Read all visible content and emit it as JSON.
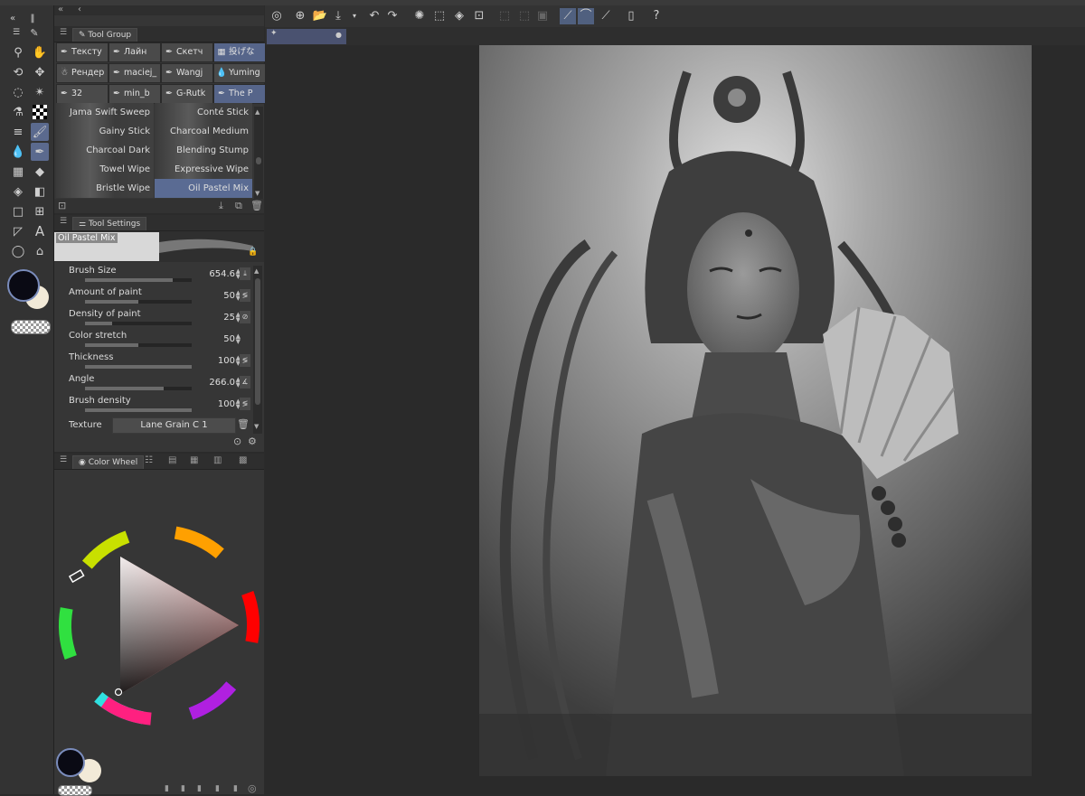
{
  "panels": {
    "tool_group_title": "Tool Group",
    "tool_settings_title": "Tool Settings",
    "color_wheel_title": "Color Wheel"
  },
  "subtools": [
    {
      "label": "Тексту",
      "icon": "pen-icon"
    },
    {
      "label": "Лайн",
      "icon": "pen-icon"
    },
    {
      "label": "Скетч",
      "icon": "pen-icon"
    },
    {
      "label": "投げな",
      "icon": "brush-icon"
    },
    {
      "label": "Рендер",
      "icon": "avatar-icon"
    },
    {
      "label": "maciej_",
      "icon": "pen-icon"
    },
    {
      "label": "Wangj",
      "icon": "pen-icon"
    },
    {
      "label": "Yuming",
      "icon": "drop-icon"
    },
    {
      "label": "32",
      "icon": "pen-icon"
    },
    {
      "label": "min_b",
      "icon": "pen-icon"
    },
    {
      "label": "G-Rutk",
      "icon": "pen-icon"
    },
    {
      "label": "The P",
      "icon": "pen-icon"
    }
  ],
  "brushes": [
    {
      "left": "Jama Swift Sweep",
      "right": "Conté Stick"
    },
    {
      "left": "Gainy Stick",
      "right": "Charcoal Medium"
    },
    {
      "left": "Charcoal Dark",
      "right": "Blending Stump"
    },
    {
      "left": "Towel Wipe",
      "right": "Expressive Wipe"
    },
    {
      "left": "Bristle Wipe",
      "right": "Oil Pastel Mix"
    }
  ],
  "tool_settings": {
    "preview_name": "Oil Pastel Mix",
    "props": [
      {
        "label": "Brush Size",
        "value": "654.6",
        "fill": 0.82
      },
      {
        "label": "Amount of paint",
        "value": "50",
        "fill": 0.5
      },
      {
        "label": "Density of paint",
        "value": "25",
        "fill": 0.25
      },
      {
        "label": "Color stretch",
        "value": "50",
        "fill": 0.5
      },
      {
        "label": "Thickness",
        "value": "100",
        "fill": 1.0
      },
      {
        "label": "Angle",
        "value": "266.0",
        "fill": 0.74
      },
      {
        "label": "Brush density",
        "value": "100",
        "fill": 1.0
      }
    ],
    "texture_label": "Texture",
    "texture_value": "Lane Grain C 1"
  },
  "colors": {
    "main": "#0a0a14",
    "sub": "#f2ead8",
    "accent": "#5b6a8e"
  }
}
